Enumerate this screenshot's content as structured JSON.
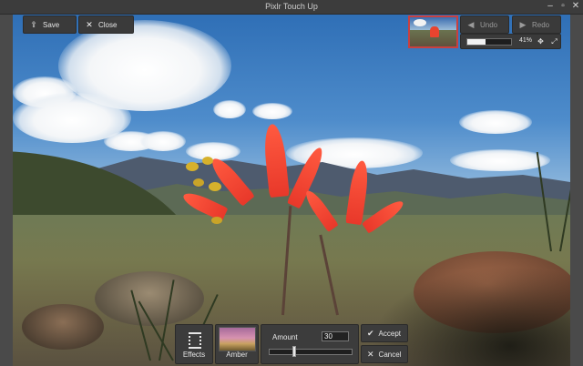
{
  "window": {
    "title": "Pixlr Touch Up",
    "minimize_icon": "minimize-icon",
    "maximize_icon": "maximize-icon",
    "close_icon": "close-icon"
  },
  "toolbar": {
    "save_label": "Save",
    "close_label": "Close",
    "undo_label": "Undo",
    "redo_label": "Redo",
    "undo_enabled": false,
    "redo_enabled": false
  },
  "zoom": {
    "level_text": "41%",
    "level_value": 0.41
  },
  "panel": {
    "effects_label": "Effects",
    "effect_name": "Amber",
    "amount_label": "Amount",
    "amount_value": "30",
    "amount_fraction": 0.3,
    "accept_label": "Accept",
    "cancel_label": "Cancel"
  },
  "colors": {
    "accent_border": "#c94040",
    "panel_bg": "#3c3c3c",
    "text": "#e6e6e6"
  }
}
